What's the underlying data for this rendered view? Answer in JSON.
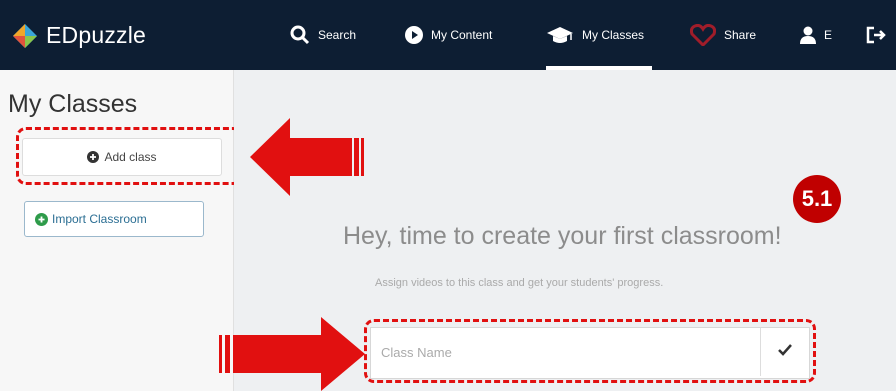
{
  "app": {
    "name": "EDpuzzle"
  },
  "nav": {
    "search": "Search",
    "my_content": "My Content",
    "my_classes": "My Classes",
    "share": "Share",
    "user_initial": "E"
  },
  "sidebar": {
    "title": "My Classes",
    "add_class": "Add class",
    "import_classroom": "Import Classroom"
  },
  "main": {
    "headline": "Hey, time to create your first classroom!",
    "subline": "Assign videos to this class and get your students' progress.",
    "class_name_placeholder": "Class Name"
  },
  "annotation": {
    "step_badge": "5.1"
  },
  "colors": {
    "topbar": "#0d1e33",
    "highlight": "#e11010",
    "badge": "#c00000",
    "arrow": "#e11010"
  }
}
